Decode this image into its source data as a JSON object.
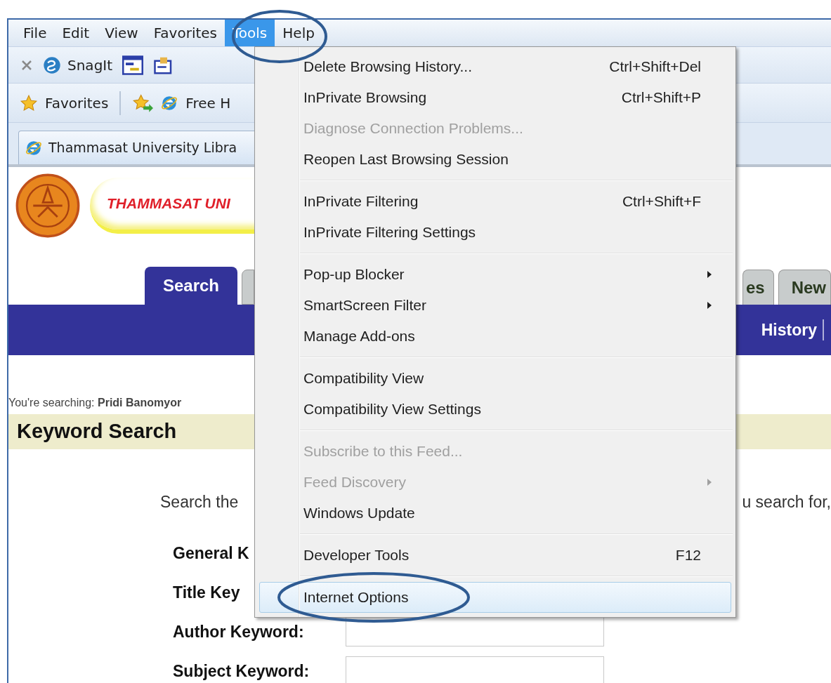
{
  "menu_bar": [
    {
      "label": "File",
      "selected": false
    },
    {
      "label": "Edit",
      "selected": false
    },
    {
      "label": "View",
      "selected": false
    },
    {
      "label": "Favorites",
      "selected": false
    },
    {
      "label": "Tools",
      "selected": true
    },
    {
      "label": "Help",
      "selected": false
    }
  ],
  "command_bar": {
    "snagit_label": "SnagIt"
  },
  "favorites_bar": {
    "favorites_label": "Favorites",
    "link": "Free H"
  },
  "tab": {
    "title": "Thammasat University Libra"
  },
  "page": {
    "banner_text": "THAMMASAT UNI",
    "tabs_left": [
      {
        "label": "Search",
        "selected": true
      }
    ],
    "tabs_right": [
      {
        "label": "es",
        "selected": false
      },
      {
        "label": "New",
        "selected": false
      }
    ],
    "nav_link": "History",
    "searching": "You're searching: **Pridi Banomyor**",
    "heading": "Keyword Search",
    "intro_left": "Search the",
    "intro_right": "u search for,",
    "fields": [
      {
        "label": "General K",
        "kind": "covered"
      },
      {
        "label": "Title Key",
        "kind": "covered"
      },
      {
        "label": "Author Keyword:",
        "kind": "input"
      },
      {
        "label": "Subject Keyword:",
        "kind": "input"
      }
    ]
  },
  "tools_menu": [
    {
      "kind": "item",
      "label": "Delete Browsing History...",
      "shortcut": "Ctrl+Shift+Del",
      "disabled": false,
      "submenu": false,
      "selected": false
    },
    {
      "kind": "item",
      "label": "InPrivate Browsing",
      "shortcut": "Ctrl+Shift+P",
      "disabled": false,
      "submenu": false,
      "selected": false
    },
    {
      "kind": "item",
      "label": "Diagnose Connection Problems...",
      "disabled": true,
      "submenu": false,
      "selected": false
    },
    {
      "kind": "item",
      "label": "Reopen Last Browsing Session",
      "disabled": false,
      "submenu": false,
      "selected": false
    },
    {
      "kind": "separator"
    },
    {
      "kind": "item",
      "label": "InPrivate Filtering",
      "shortcut": "Ctrl+Shift+F",
      "disabled": false,
      "submenu": false,
      "selected": false
    },
    {
      "kind": "item",
      "label": "InPrivate Filtering Settings",
      "disabled": false,
      "submenu": false,
      "selected": false
    },
    {
      "kind": "separator"
    },
    {
      "kind": "item",
      "label": "Pop-up Blocker",
      "disabled": false,
      "submenu": true,
      "selected": false
    },
    {
      "kind": "item",
      "label": "SmartScreen Filter",
      "disabled": false,
      "submenu": true,
      "selected": false
    },
    {
      "kind": "item",
      "label": "Manage Add-ons",
      "disabled": false,
      "submenu": false,
      "selected": false
    },
    {
      "kind": "separator"
    },
    {
      "kind": "item",
      "label": "Compatibility View",
      "disabled": false,
      "submenu": false,
      "selected": false
    },
    {
      "kind": "item",
      "label": "Compatibility View Settings",
      "disabled": false,
      "submenu": false,
      "selected": false
    },
    {
      "kind": "separator"
    },
    {
      "kind": "item",
      "label": "Subscribe to this Feed...",
      "disabled": true,
      "submenu": false,
      "selected": false
    },
    {
      "kind": "item",
      "label": "Feed Discovery",
      "disabled": true,
      "submenu": true,
      "selected": false
    },
    {
      "kind": "item",
      "label": "Windows Update",
      "disabled": false,
      "submenu": false,
      "selected": false
    },
    {
      "kind": "separator"
    },
    {
      "kind": "item",
      "label": "Developer Tools",
      "shortcut": "F12",
      "disabled": false,
      "submenu": false,
      "selected": false
    },
    {
      "kind": "separator"
    },
    {
      "kind": "item",
      "label": "Internet Options",
      "disabled": false,
      "submenu": false,
      "selected": true
    }
  ]
}
